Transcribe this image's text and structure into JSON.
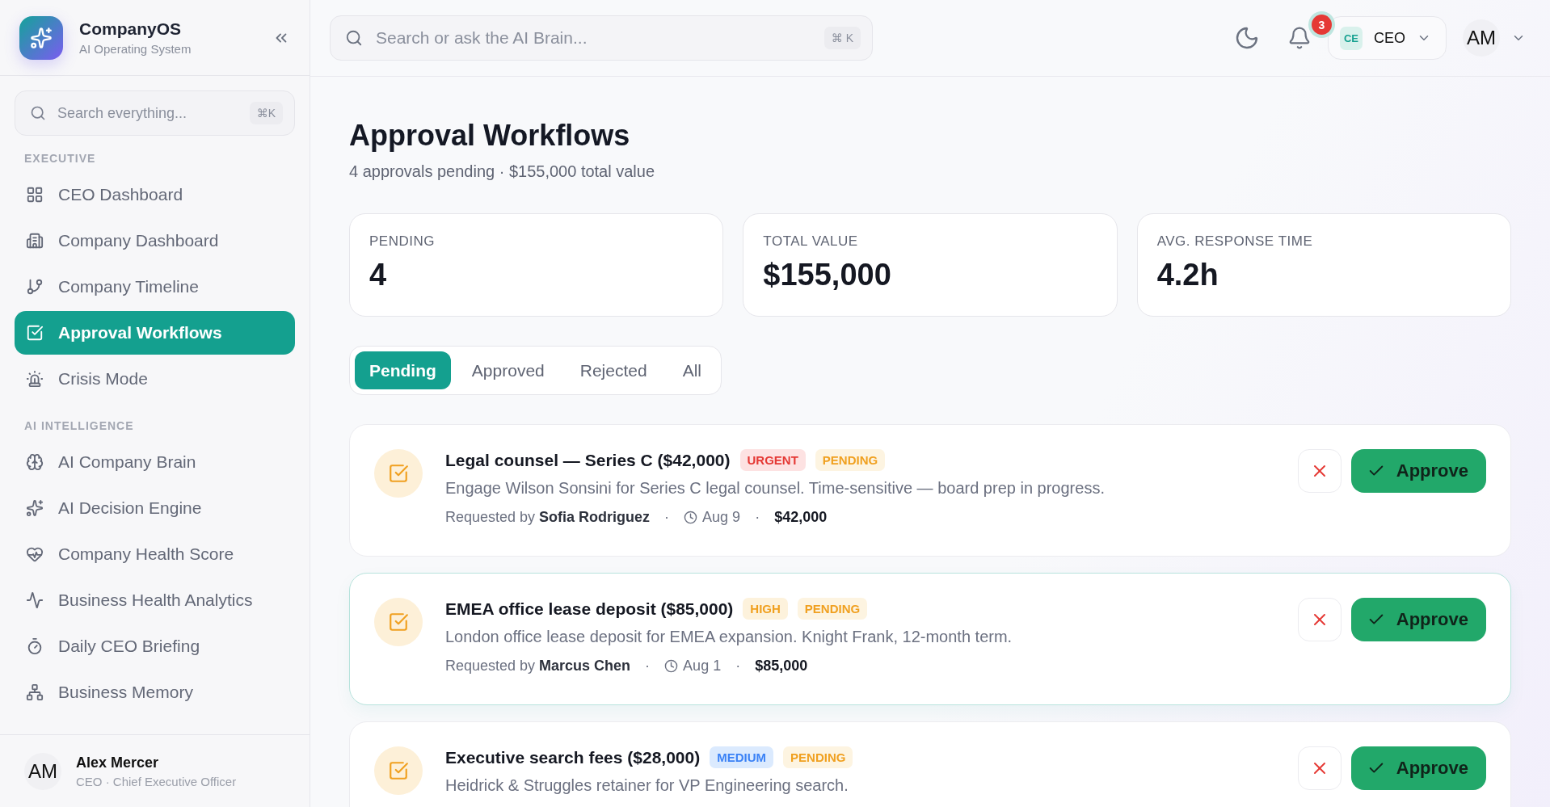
{
  "brand": {
    "name": "CompanyOS",
    "tagline": "AI Operating System"
  },
  "sidebar": {
    "search": {
      "placeholder": "Search everything...",
      "shortcut": "⌘K"
    },
    "sections": [
      {
        "title": "EXECUTIVE",
        "items": [
          {
            "label": "CEO Dashboard",
            "selected": false
          },
          {
            "label": "Company Dashboard",
            "selected": false
          },
          {
            "label": "Company Timeline",
            "selected": false
          },
          {
            "label": "Approval Workflows",
            "selected": true
          },
          {
            "label": "Crisis Mode",
            "selected": false
          }
        ]
      },
      {
        "title": "AI INTELLIGENCE",
        "items": [
          {
            "label": "AI Company Brain",
            "selected": false
          },
          {
            "label": "AI Decision Engine",
            "selected": false
          },
          {
            "label": "Company Health Score",
            "selected": false
          },
          {
            "label": "Business Health Analytics",
            "selected": false
          },
          {
            "label": "Daily CEO Briefing",
            "selected": false
          },
          {
            "label": "Business Memory",
            "selected": false
          }
        ]
      }
    ],
    "user": {
      "initials": "AM",
      "name": "Alex Mercer",
      "role": "CEO · Chief Executive Officer"
    }
  },
  "header": {
    "search": {
      "placeholder": "Search or ask the AI Brain...",
      "shortcut": "⌘ K"
    },
    "notifications": "3",
    "role": {
      "badge": "CE",
      "label": "CEO"
    },
    "avatar": "AM"
  },
  "page": {
    "title": "Approval Workflows",
    "subtitle": "4 approvals pending · $155,000 total value"
  },
  "stats": [
    {
      "label": "PENDING",
      "value": "4"
    },
    {
      "label": "TOTAL VALUE",
      "value": "$155,000"
    },
    {
      "label": "AVG. RESPONSE TIME",
      "value": "4.2h"
    }
  ],
  "tabs": [
    {
      "label": "Pending",
      "selected": true
    },
    {
      "label": "Approved",
      "selected": false
    },
    {
      "label": "Rejected",
      "selected": false
    },
    {
      "label": "All",
      "selected": false
    }
  ],
  "meta_separator": "·",
  "approvals": [
    {
      "title": "Legal counsel — Series C ($42,000)",
      "priority": {
        "label": "URGENT",
        "kind": "urgent"
      },
      "status": {
        "label": "PENDING",
        "kind": "pending"
      },
      "description": "Engage Wilson Sonsini for Series C legal counsel. Time-sensitive — board prep in progress.",
      "requested": "Requested by **Sofia Rodriguez**",
      "date": "Aug 9",
      "amount": "$42,000",
      "highlighted": false,
      "approve": "Approve"
    },
    {
      "title": "EMEA office lease deposit ($85,000)",
      "priority": {
        "label": "HIGH",
        "kind": "high"
      },
      "status": {
        "label": "PENDING",
        "kind": "pending"
      },
      "description": "London office lease deposit for EMEA expansion. Knight Frank, 12-month term.",
      "requested": "Requested by **Marcus Chen**",
      "date": "Aug 1",
      "amount": "$85,000",
      "highlighted": true,
      "approve": "Approve"
    },
    {
      "title": "Executive search fees ($28,000)",
      "priority": {
        "label": "MEDIUM",
        "kind": "medium"
      },
      "status": {
        "label": "PENDING",
        "kind": "pending"
      },
      "description": "Heidrick & Struggles retainer for VP Engineering search.",
      "highlighted": false,
      "approve": "Approve"
    }
  ]
}
